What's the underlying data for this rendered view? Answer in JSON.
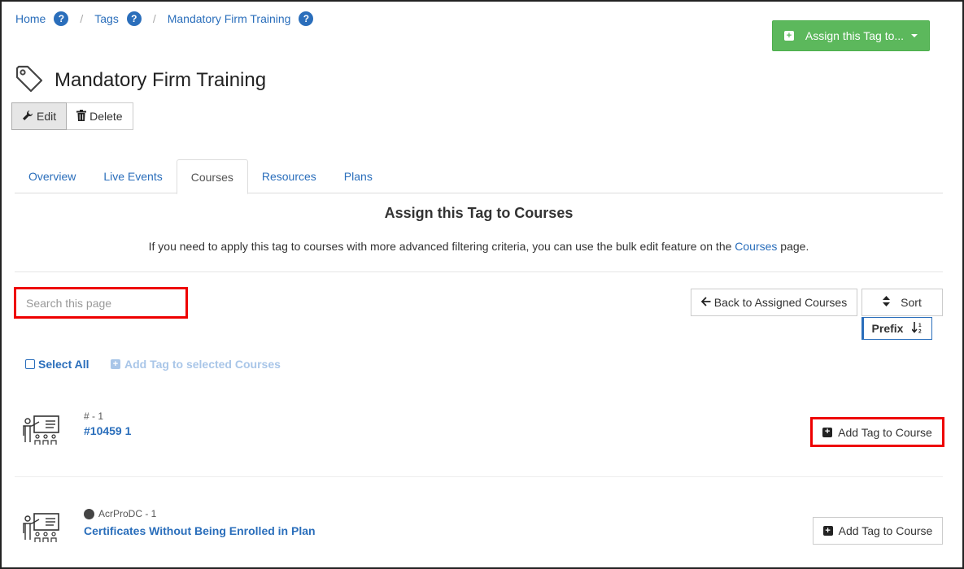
{
  "breadcrumb": {
    "items": [
      "Home",
      "Tags",
      "Mandatory Firm Training"
    ],
    "separator": "/",
    "help_glyph": "?"
  },
  "assign_button": {
    "label": "Assign this Tag to...",
    "color": "#5cb85c"
  },
  "page": {
    "title": "Mandatory Firm Training",
    "edit_label": "Edit",
    "delete_label": "Delete"
  },
  "tabs": [
    {
      "label": "Overview",
      "active": false
    },
    {
      "label": "Live Events",
      "active": false
    },
    {
      "label": "Courses",
      "active": true
    },
    {
      "label": "Resources",
      "active": false
    },
    {
      "label": "Plans",
      "active": false
    }
  ],
  "section": {
    "title": "Assign this Tag to Courses",
    "desc_before": "If you need to apply this tag to courses with more advanced filtering criteria, you can use the bulk edit feature on the ",
    "desc_link": "Courses",
    "desc_after": " page."
  },
  "search": {
    "placeholder": "Search this page",
    "value": ""
  },
  "toolbar": {
    "back_label": "Back to Assigned Courses",
    "sort_label": "Sort",
    "prefix_label": "Prefix",
    "select_all_label": "Select All",
    "add_selected_label": "Add Tag to selected Courses"
  },
  "courses": [
    {
      "meta": "# - 1",
      "name": "#10459 1",
      "has_dot": false,
      "button_label": "Add Tag to Course"
    },
    {
      "meta": "AcrProDC - 1",
      "name": "Certificates Without Being Enrolled in Plan",
      "has_dot": true,
      "button_label": "Add Tag to Course"
    }
  ],
  "icons": {
    "help": "question-circle-icon",
    "tag": "tag-icon",
    "edit": "wrench-icon",
    "delete": "trash-icon",
    "back": "arrow-left-icon",
    "sort": "sort-icon",
    "prefix_sort": "sort-alpha-icon",
    "course": "presentation-class-icon",
    "plus": "plus-square-icon"
  },
  "colors": {
    "link": "#2a6ebb",
    "highlight": "#e00000",
    "disabled_link": "#a9c6e8"
  }
}
